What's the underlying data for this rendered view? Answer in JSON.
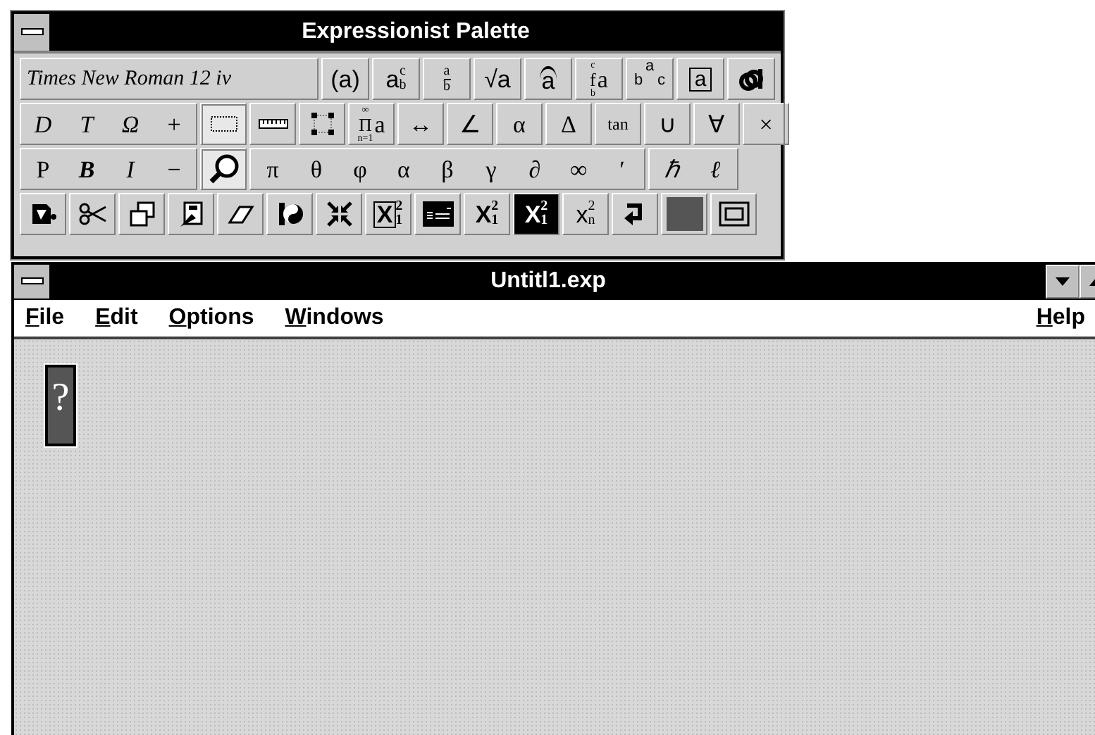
{
  "palette": {
    "title": "Expressionist Palette",
    "font_field": {
      "value": "Times New Roman 12 iv"
    },
    "rows": [
      {
        "groups": [
          {
            "buttons": [
              {
                "kind": "text",
                "label": "(a)",
                "selected": false
              }
            ]
          },
          {
            "buttons": [
              {
                "kind": "script",
                "base": "a",
                "sup": "c",
                "sub": "b",
                "selected": false
              }
            ]
          },
          {
            "buttons": [
              {
                "kind": "fraction",
                "num": "a",
                "den": "b",
                "selected": false
              }
            ]
          },
          {
            "buttons": [
              {
                "kind": "text",
                "label": "√a",
                "selected": false
              }
            ]
          },
          {
            "buttons": [
              {
                "kind": "accent",
                "base": "a",
                "selected": false
              }
            ]
          },
          {
            "buttons": [
              {
                "kind": "limits",
                "base": "f",
                "sup": "c",
                "sub": "b",
                "tail": "a",
                "selected": false
              }
            ]
          },
          {
            "buttons": [
              {
                "kind": "tree",
                "top": "a",
                "left": "b",
                "right": "c",
                "selected": false
              }
            ]
          },
          {
            "buttons": [
              {
                "kind": "boxed",
                "label": "a",
                "selected": false
              }
            ]
          },
          {
            "buttons": [
              {
                "kind": "icon",
                "selected": false
              }
            ]
          }
        ]
      },
      {
        "groups": [
          {
            "buttons": [
              {
                "kind": "text",
                "label": "D",
                "selected": false
              },
              {
                "kind": "text",
                "label": "T",
                "selected": false
              },
              {
                "kind": "text",
                "label": "Ω",
                "selected": false
              },
              {
                "kind": "text",
                "label": "+",
                "selected": false
              }
            ]
          },
          {
            "buttons": [
              {
                "kind": "icon",
                "selected": true
              }
            ]
          },
          {
            "buttons": [
              {
                "kind": "icon",
                "selected": false
              }
            ]
          },
          {
            "buttons": [
              {
                "kind": "icon",
                "selected": false
              }
            ]
          },
          {
            "buttons": [
              {
                "kind": "limits",
                "base": "Π",
                "sup": "∞",
                "sub": "n=1",
                "tail": "a",
                "selected": false
              }
            ]
          },
          {
            "buttons": [
              {
                "kind": "text",
                "label": "↔",
                "selected": false
              }
            ]
          },
          {
            "buttons": [
              {
                "kind": "text",
                "label": "∠",
                "selected": false
              }
            ]
          },
          {
            "buttons": [
              {
                "kind": "text",
                "label": "α",
                "selected": false
              }
            ]
          },
          {
            "buttons": [
              {
                "kind": "text",
                "label": "Δ",
                "selected": false
              }
            ]
          },
          {
            "buttons": [
              {
                "kind": "text",
                "label": "tan",
                "selected": false
              }
            ]
          },
          {
            "buttons": [
              {
                "kind": "text",
                "label": "∪",
                "selected": false
              }
            ]
          },
          {
            "buttons": [
              {
                "kind": "text",
                "label": "∀",
                "selected": false
              }
            ]
          },
          {
            "buttons": [
              {
                "kind": "text",
                "label": "×",
                "selected": false
              }
            ]
          }
        ]
      },
      {
        "groups": [
          {
            "buttons": [
              {
                "kind": "text",
                "label": "P",
                "selected": false
              },
              {
                "kind": "text",
                "label": "B",
                "selected": false
              },
              {
                "kind": "text",
                "label": "I",
                "selected": false
              },
              {
                "kind": "text",
                "label": "−",
                "selected": false
              }
            ]
          },
          {
            "buttons": [
              {
                "kind": "icon",
                "selected": true
              }
            ]
          },
          {
            "buttons": [
              {
                "kind": "text",
                "label": "π",
                "selected": false
              },
              {
                "kind": "text",
                "label": "θ",
                "selected": false
              },
              {
                "kind": "text",
                "label": "φ",
                "selected": false
              },
              {
                "kind": "text",
                "label": "α",
                "selected": false
              },
              {
                "kind": "text",
                "label": "β",
                "selected": false
              },
              {
                "kind": "text",
                "label": "γ",
                "selected": false
              },
              {
                "kind": "text",
                "label": "∂",
                "selected": false
              },
              {
                "kind": "text",
                "label": "∞",
                "selected": false
              },
              {
                "kind": "text",
                "label": "′",
                "selected": false
              }
            ]
          },
          {
            "buttons": [
              {
                "kind": "text",
                "label": "ℏ",
                "selected": false
              },
              {
                "kind": "text",
                "label": "ℓ",
                "selected": false
              }
            ]
          }
        ]
      },
      {
        "groups": [
          {
            "buttons": [
              {
                "kind": "icon",
                "selected": false
              }
            ]
          },
          {
            "buttons": [
              {
                "kind": "icon",
                "selected": false
              }
            ]
          },
          {
            "buttons": [
              {
                "kind": "icon",
                "selected": false
              }
            ]
          },
          {
            "buttons": [
              {
                "kind": "icon",
                "selected": false
              }
            ]
          },
          {
            "buttons": [
              {
                "kind": "icon",
                "selected": false
              }
            ]
          },
          {
            "buttons": [
              {
                "kind": "icon",
                "selected": false
              }
            ]
          },
          {
            "buttons": [
              {
                "kind": "icon",
                "selected": false
              }
            ]
          },
          {
            "buttons": [
              {
                "kind": "script",
                "base": "X",
                "sup": "2",
                "sub": "1",
                "selected": false
              }
            ]
          },
          {
            "buttons": [
              {
                "kind": "icon",
                "selected": false
              }
            ]
          },
          {
            "buttons": [
              {
                "kind": "script",
                "base": "X",
                "sup": "2",
                "sub": "1",
                "selected": false
              }
            ]
          },
          {
            "buttons": [
              {
                "kind": "script",
                "base": "X",
                "sup": "2",
                "sub": "1",
                "selected": false
              }
            ]
          },
          {
            "buttons": [
              {
                "kind": "script",
                "base": "x",
                "sup": "2",
                "sub": "n",
                "selected": false
              }
            ]
          },
          {
            "buttons": [
              {
                "kind": "icon",
                "selected": false
              }
            ]
          },
          {
            "buttons": [
              {
                "kind": "icon",
                "selected": false
              }
            ]
          },
          {
            "buttons": [
              {
                "kind": "icon",
                "selected": false
              }
            ]
          }
        ]
      }
    ]
  },
  "document": {
    "title": "Untitl1.exp",
    "menu": [
      {
        "label": "File"
      },
      {
        "label": "Edit"
      },
      {
        "label": "Options"
      },
      {
        "label": "Windows"
      }
    ],
    "help": {
      "label": "Help"
    },
    "placeholder_box": {
      "label": "?"
    }
  }
}
